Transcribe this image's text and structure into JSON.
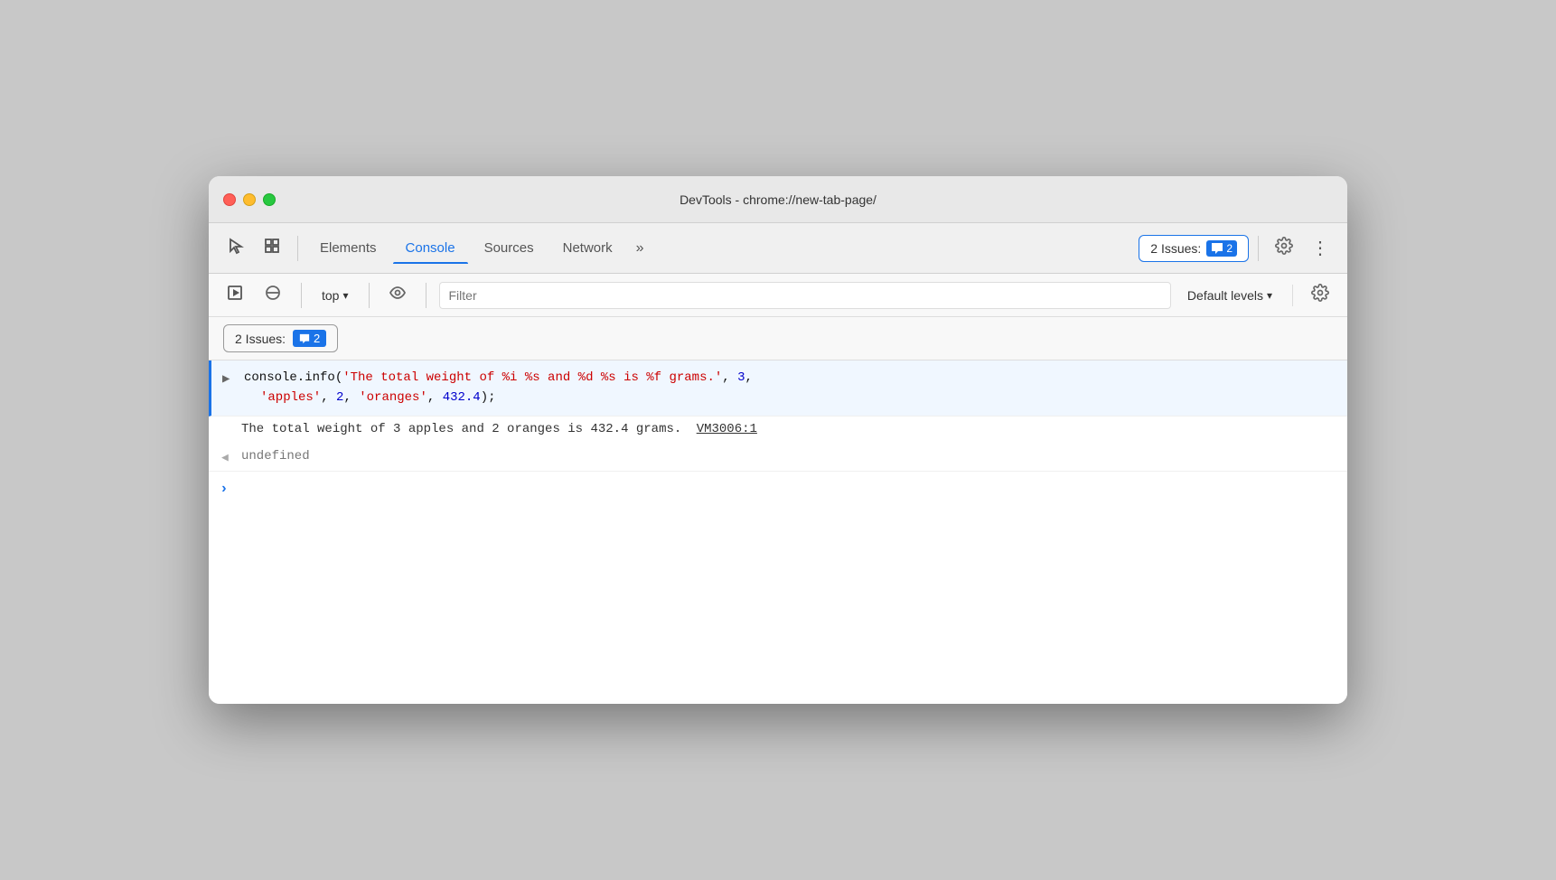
{
  "window": {
    "title": "DevTools - chrome://new-tab-page/"
  },
  "toolbar": {
    "tabs": [
      {
        "id": "elements",
        "label": "Elements",
        "active": false
      },
      {
        "id": "console",
        "label": "Console",
        "active": true
      },
      {
        "id": "sources",
        "label": "Sources",
        "active": false
      },
      {
        "id": "network",
        "label": "Network",
        "active": false
      }
    ],
    "issues_badge_label": "2 Issues:",
    "issues_count": "2",
    "more_tabs_label": "»"
  },
  "console_toolbar": {
    "context_label": "top",
    "filter_placeholder": "Filter",
    "levels_label": "Default levels"
  },
  "console_output": {
    "entry1": {
      "code_line1": "console.info('The total weight of %i %s and %d %s is %f grams.', 3,",
      "code_line2": "'apples', 2, 'oranges', 432.4);"
    },
    "entry1_output": "The total weight of 3 apples and 2 oranges is 432.4 grams.",
    "entry1_vm_link": "VM3006:1",
    "entry2_undefined": "undefined",
    "prompt_symbol": ">"
  },
  "issues_bar": {
    "issues_text": "2 Issues:",
    "count": "2"
  },
  "icons": {
    "cursor": "↖",
    "layers": "⧉",
    "play": "▶",
    "block": "⊘",
    "eye": "◉",
    "chevron_down": "▾",
    "gear": "⚙",
    "more": "⋮",
    "chat": "💬",
    "arrow_right": "›",
    "arrow_left": "‹"
  }
}
